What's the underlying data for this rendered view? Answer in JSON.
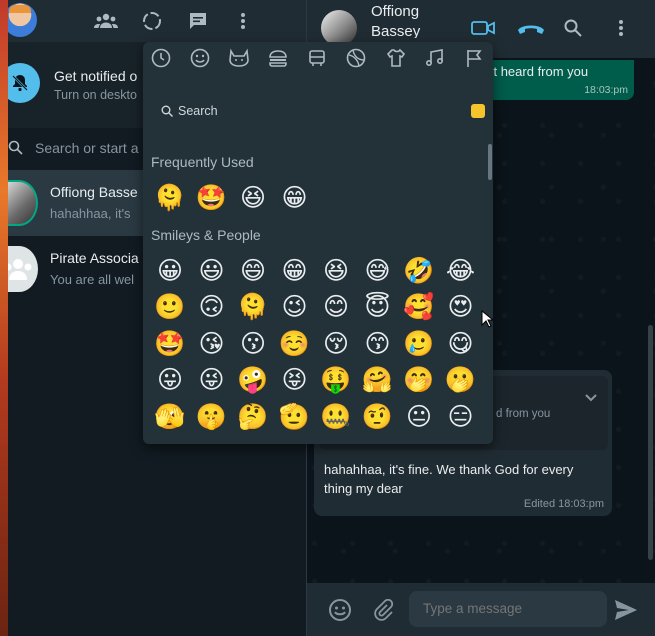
{
  "sidebar": {
    "notify": {
      "title": "Get notified o",
      "subtitle": "Turn on deskto"
    },
    "search_placeholder": "Search or start a",
    "chats": [
      {
        "name": "Offiong Basse",
        "preview": "hahahhaa, it's"
      },
      {
        "name": "Pirate Associa",
        "preview": "You are all wel"
      }
    ]
  },
  "conversation": {
    "contact_name": "Offiong Bassey",
    "outgoing": {
      "text": "'t heard from you",
      "time": "18:03:pm"
    },
    "incoming": {
      "quoted_text": "d from you",
      "text": "hahahhaa, it's fine. We thank God for every thing my dear",
      "time": "Edited 18:03:pm"
    },
    "input_placeholder": "Type a message"
  },
  "emoji_picker": {
    "search_label": "Search",
    "sections": [
      {
        "title": "Frequently Used",
        "emojis": [
          "🫠",
          "🤩",
          "😆",
          "😁"
        ]
      },
      {
        "title": "Smileys & People",
        "emojis": [
          "😀",
          "😃",
          "😄",
          "😁",
          "😆",
          "😅",
          "🤣",
          "😂",
          "🙂",
          "🙃",
          "🫠",
          "😉",
          "😊",
          "😇",
          "🥰",
          "😍",
          "🤩",
          "😘",
          "😗",
          "☺️",
          "😚",
          "😙",
          "🥲",
          "😋",
          "😛",
          "😜",
          "🤪",
          "😝",
          "🤑",
          "🤗",
          "🤭",
          "🫢",
          "🫣",
          "🤫",
          "🤔",
          "🫡",
          "🤐",
          "🤨",
          "😐",
          "😑"
        ]
      }
    ]
  },
  "colors": {
    "accent_green": "#005c4b",
    "blue": "#53bdeb",
    "skin_tone": "#f5c52b"
  }
}
